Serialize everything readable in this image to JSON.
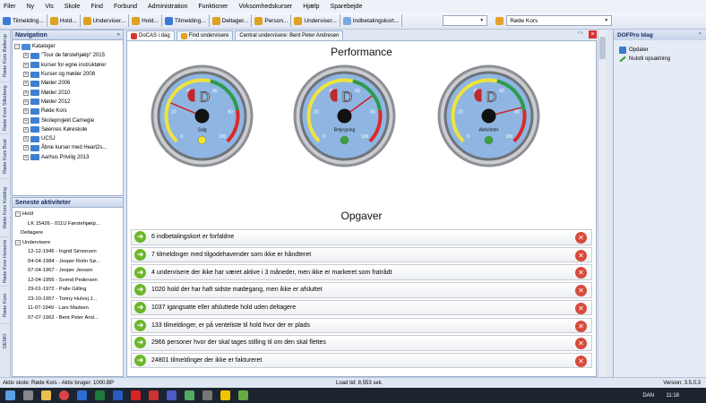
{
  "menu": [
    "Filer",
    "Ny",
    "Vis",
    "Skole",
    "Find",
    "Forbund",
    "Administration",
    "Funktioner",
    "Virksomhedskurser",
    "Hjælp",
    "Sparebejde"
  ],
  "toolbar": {
    "items": [
      {
        "label": "Tilmelding...",
        "color": "#3a7bd5"
      },
      {
        "label": "Hold...",
        "color": "#e0a020"
      },
      {
        "label": "Underviser...",
        "color": "#e0a020"
      },
      {
        "label": "Hold...",
        "color": "#e0a020"
      },
      {
        "label": "Tilmelding...",
        "color": "#3a7bd5"
      },
      {
        "label": "Deltager...",
        "color": "#e0a020"
      },
      {
        "label": "Person...",
        "color": "#e0a020"
      },
      {
        "label": "Underviser...",
        "color": "#e0a020"
      },
      {
        "label": "Indbetalingskort...",
        "color": "#7fa8e0"
      }
    ],
    "combo1": "",
    "combo2": "Røde Kors"
  },
  "vtabs": [
    "Røde Kors Ballerup",
    "Røde Kors Silkeborg",
    "Røde Kors Bust",
    "Røde Kors Kolding",
    "Røde Kors Horsens",
    "Røde Kors",
    "DEMO"
  ],
  "navigation": {
    "title": "Navigation",
    "root": "Kataloger",
    "items": [
      "\"Tour de førstehjælp\" 2015",
      "kurser for egne instruktører",
      "Kurser og møder 2008",
      "Møder 2006",
      "Møder 2010",
      "Møder 2012",
      "Røde Kors",
      "Skoleprojekt Carnegie",
      "Søernes Køreskole",
      "UCSJ",
      "Åbne kurser med Heart2s...",
      "Aarhus Privilig 2013"
    ]
  },
  "recent": {
    "title": "Seneste aktiviteter",
    "hold_label": "Hold",
    "hold_item": "LK 15426 - 011U Førstehjælp...",
    "deltagere_label": "Deltagere",
    "undervisere_label": "Undervisere",
    "undervisere": [
      "12-12-1946 - Ingrid Simonsen",
      "04-04-1984 - Jesper Rolin Sø...",
      "07-04-1967 - Jesper Jensen",
      "12-04-1956 - Svend Pedersen",
      "29-01-1972 - Palle Gilling",
      "23-10-1957 - Tonny Hulvej J...",
      "11-07-1949 - Lars Madsen",
      "07-07-1962 - Bent Peter And..."
    ]
  },
  "tabs": [
    "DoCAS i dag",
    "Find undervisere",
    "Central undervisere: Bent Peter Andresen"
  ],
  "performance_title": "Performance",
  "gauges": [
    {
      "label": "Salg",
      "value": 25,
      "light": "#f2e330"
    },
    {
      "label": "Betjegning",
      "value": 70,
      "light": "#3aa23a"
    },
    {
      "label": "Aktiviteter",
      "value": 78,
      "light": "#3aa23a"
    }
  ],
  "gauge_ticks": [
    "0",
    "20",
    "40",
    "60",
    "80",
    "100"
  ],
  "opgaver_title": "Opgaver",
  "tasks": [
    "6 indbetalingskort er forfaldne",
    "7 tilmeldinger med tilgodehavender som ikke er håndteret",
    "4 undervisere der ikke har været aktive i 3 måneder, men ikke er markeret som fratrådt",
    "1020 hold der har haft sidste mødegang, men ikke er afsluttet",
    "1037 igangsatte eller afsluttede hold uden deltagere",
    "133 tilmeldinger, er på venteliste til hold hvor der er plads",
    "2966 personer hvor der skal tages stilling til om den skal flettes",
    "24801 tilmeldinger der ikke er faktureret"
  ],
  "right_panel": {
    "title": "DOFPro Idag",
    "items": [
      "Opdater",
      "Nulstil opsætning"
    ]
  },
  "status": {
    "left": "Aktiv skole: Røde Kors - Aktiv bruger: 1000.BP",
    "middle": "Load tid: 8,553 sek.",
    "right": "Version: 3.5.0.3"
  },
  "taskbar": {
    "time": "11:18",
    "lang": "DAN"
  }
}
